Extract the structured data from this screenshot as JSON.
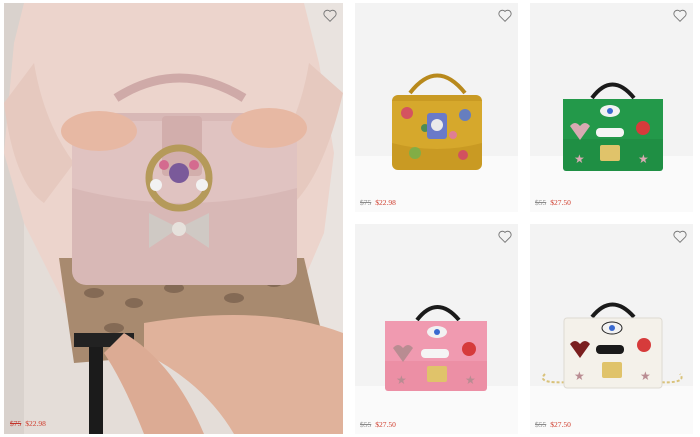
{
  "products": [
    {
      "name": "blush-jeweled-handbag",
      "old_price": "$75",
      "new_price": "$22.98",
      "colors": {
        "bag": "#d8b8b6",
        "bow": "#cfc9c4",
        "sweater": "#ecd4cc"
      }
    },
    {
      "name": "mustard-floral-handbag",
      "old_price": "$75",
      "new_price": "$22.98",
      "colors": {
        "bag": "#c99a23"
      }
    },
    {
      "name": "green-patch-handbag",
      "old_price": "$55",
      "new_price": "$27.50",
      "colors": {
        "bag": "#1f8f44"
      }
    },
    {
      "name": "pink-patch-handbag",
      "old_price": "$55",
      "new_price": "$27.50",
      "colors": {
        "bag": "#ec8fa5"
      }
    },
    {
      "name": "white-patch-handbag",
      "old_price": "$55",
      "new_price": "$27.50",
      "colors": {
        "bag": "#f4f1ea"
      }
    }
  ],
  "icons": {
    "favorite": "heart-outline-icon"
  },
  "theme": {
    "sale_price": "#cf3b2b",
    "original_price": "#8a8a8a"
  }
}
